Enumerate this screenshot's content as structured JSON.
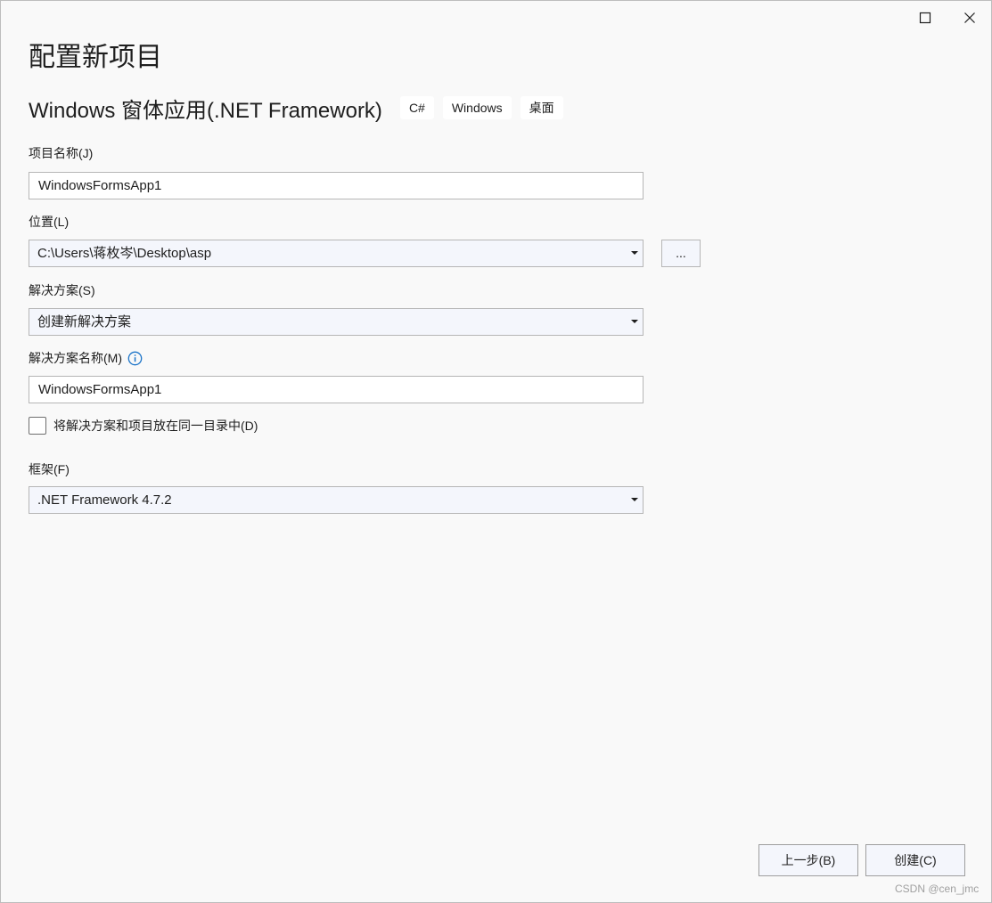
{
  "window": {
    "maximize_icon": "maximize-icon",
    "close_icon": "close-icon"
  },
  "page_title": "配置新项目",
  "template": {
    "name": "Windows 窗体应用(.NET Framework)",
    "tags": [
      "C#",
      "Windows",
      "桌面"
    ]
  },
  "project_name": {
    "label": "项目名称(J)",
    "value": "WindowsFormsApp1"
  },
  "location": {
    "label": "位置(L)",
    "value": "C:\\Users\\蒋枚岑\\Desktop\\asp",
    "browse_label": "..."
  },
  "solution": {
    "label": "解决方案(S)",
    "value": "创建新解决方案"
  },
  "solution_name": {
    "label": "解决方案名称(M)",
    "info_icon": "info-icon",
    "value": "WindowsFormsApp1"
  },
  "same_directory": {
    "label": "将解决方案和项目放在同一目录中(D)",
    "checked": false
  },
  "framework": {
    "label": "框架(F)",
    "value": ".NET Framework 4.7.2"
  },
  "buttons": {
    "back": "上一步(B)",
    "create": "创建(C)"
  },
  "watermark": "CSDN @cen_jmc",
  "colors": {
    "background": "#f9f9f9",
    "info_icon": "#1a73c8",
    "field_border": "#b6b6b6"
  }
}
